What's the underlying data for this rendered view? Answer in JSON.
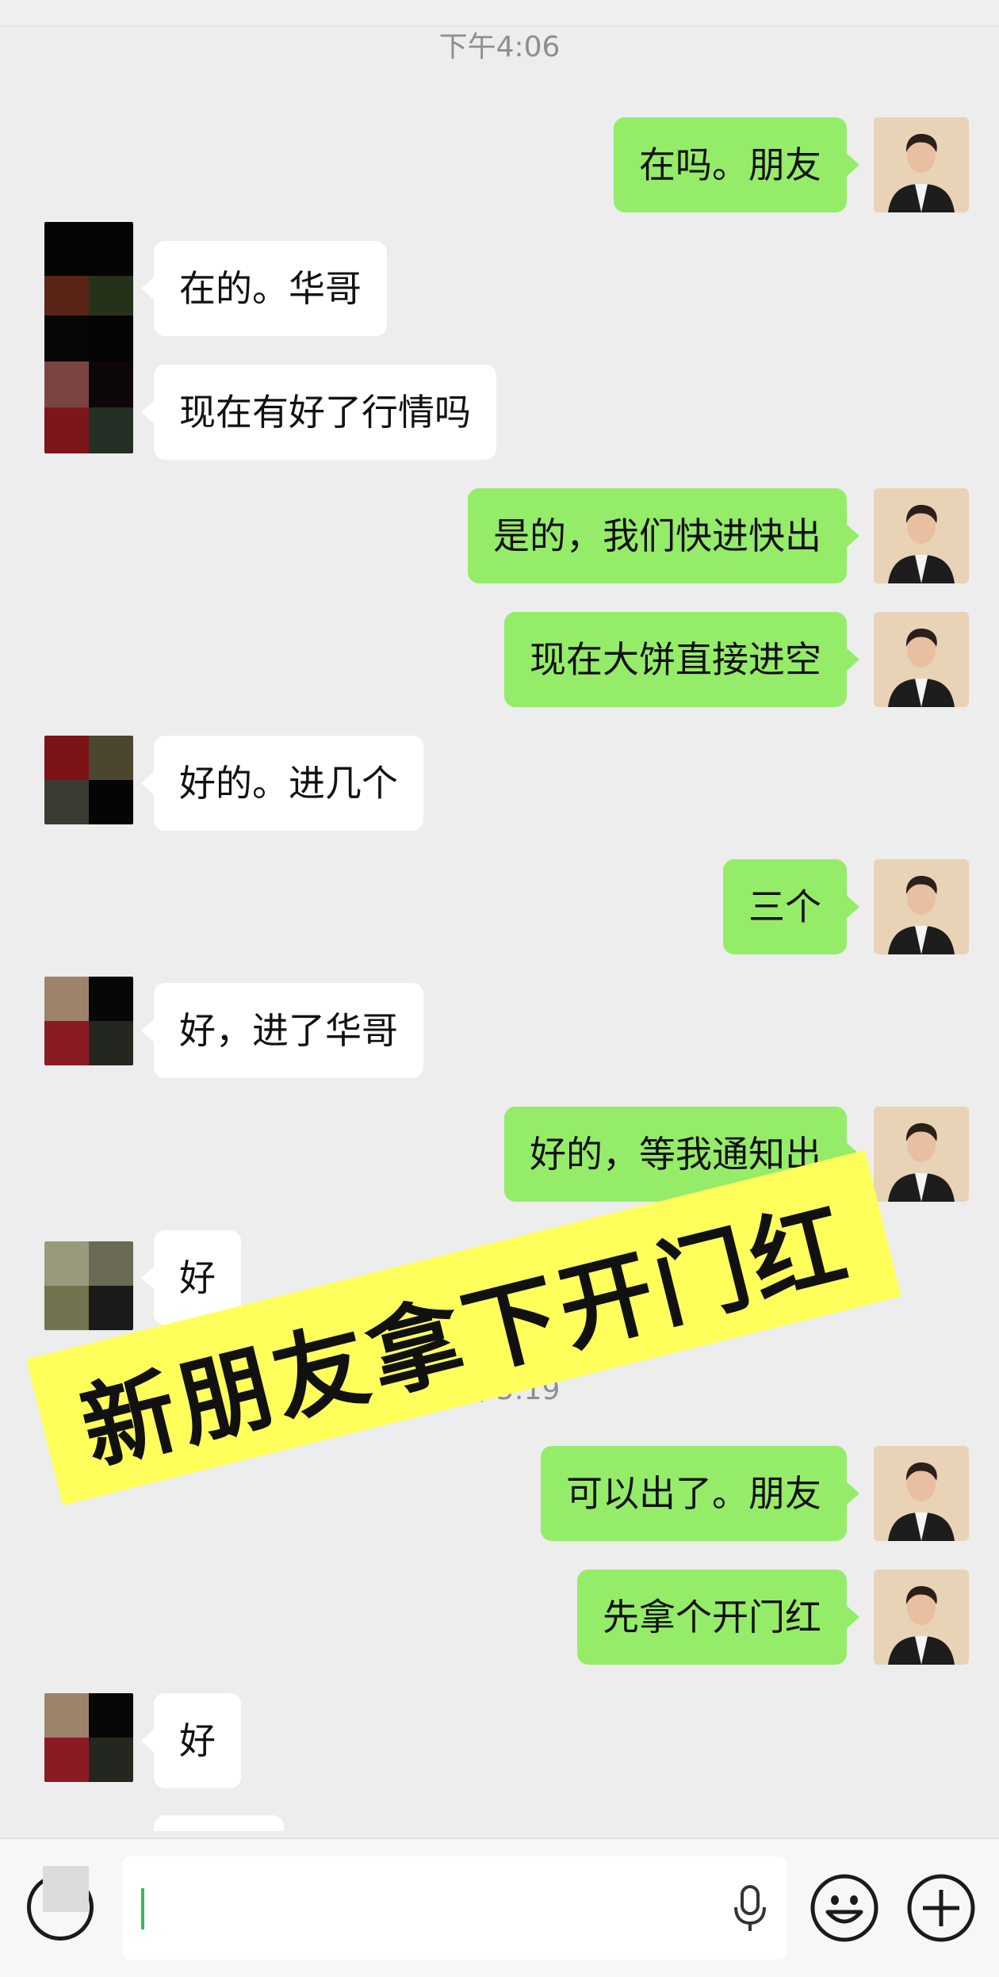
{
  "timestamps": [
    "下午4:06",
    "下午5:19"
  ],
  "messages": [
    {
      "side": "me",
      "text": "在吗。朋友"
    },
    {
      "side": "friend",
      "text": "在的。华哥"
    },
    {
      "side": "friend",
      "text": "现在有好了行情吗"
    },
    {
      "side": "me",
      "text": "是的，我们快进快出"
    },
    {
      "side": "me",
      "text": "现在大饼直接进空"
    },
    {
      "side": "friend",
      "text": "好的。进几个"
    },
    {
      "side": "me",
      "text": "三个"
    },
    {
      "side": "friend",
      "text": "好，进了华哥"
    },
    {
      "side": "me",
      "text": "好的，等我通知出"
    },
    {
      "side": "friend",
      "text": "好"
    },
    {
      "side": "me",
      "text": "可以出了。朋友"
    },
    {
      "side": "me",
      "text": "先拿个开门红"
    },
    {
      "side": "friend",
      "text": "好"
    }
  ],
  "overlay_banner": "新朋友拿下开门红",
  "colors": {
    "my_bubble": "#95ec69",
    "friend_bubble": "#ffffff",
    "banner": "#ffff5c",
    "background": "#ededed"
  },
  "input_bar": {
    "value": "",
    "voice_icon": "voice-icon",
    "mic_icon": "mic-icon",
    "emoji_icon": "emoji-icon",
    "plus_icon": "plus-icon"
  }
}
